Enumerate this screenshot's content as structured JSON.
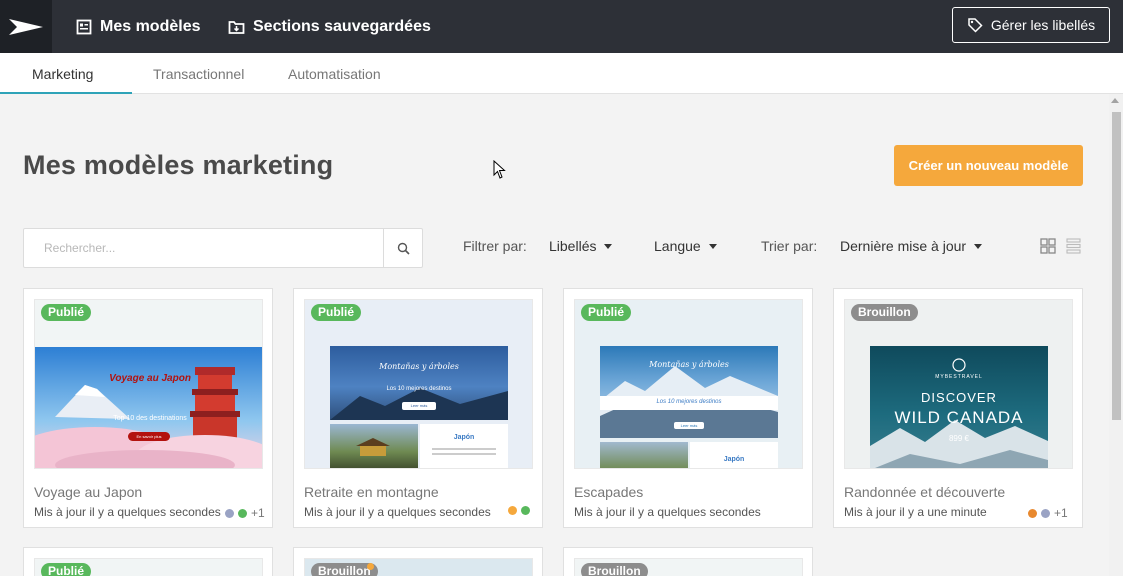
{
  "topbar": {
    "my_templates": "Mes modèles",
    "saved_sections": "Sections sauvegardées",
    "manage_labels": "Gérer les libellés"
  },
  "tabs": [
    {
      "label": "Marketing",
      "active": true
    },
    {
      "label": "Transactionnel",
      "active": false
    },
    {
      "label": "Automatisation",
      "active": false
    }
  ],
  "header": {
    "title": "Mes modèles marketing",
    "create_button": "Créer un nouveau modèle"
  },
  "search": {
    "placeholder": "Rechercher..."
  },
  "filters": {
    "filter_by": "Filtrer par:",
    "labels": "Libellés",
    "language": "Langue",
    "sort_by": "Trier par:",
    "sort_value": "Dernière mise à jour"
  },
  "colors": {
    "accent": "#f5a83c",
    "tab_underline": "#2ea3b8",
    "published": "#58b85c",
    "draft": "#8d8d8d"
  },
  "cards": [
    {
      "status": "Publié",
      "name": "Voyage au Japon",
      "updated": "Mis à jour il y a quelques secondes",
      "dots": [
        "#9aa3c4",
        "#58b85c"
      ],
      "more": "+1",
      "hero_title": "Voyage au Japon",
      "hero_sub": "Top 10 des destinations",
      "hero_cta": "En savoir plus"
    },
    {
      "status": "Publié",
      "name": "Retraite en montagne",
      "updated": "Mis à jour il y a quelques secondes",
      "dots": [
        "#f5a83c",
        "#58b85c"
      ],
      "more": "",
      "hero_title": "Montañas y árboles",
      "hero_sub": "Los 10 mejores destinos",
      "hero_cta": "Leer más",
      "sub_title": "Japón"
    },
    {
      "status": "Publié",
      "name": "Escapades",
      "updated": "Mis à jour il y a quelques secondes",
      "dots": [],
      "more": "",
      "hero_title": "Montañas y árboles",
      "hero_sub": "Los 10 mejores destinos",
      "hero_cta": "Leer más",
      "sub_title": "Japón"
    },
    {
      "status": "Brouillon",
      "name": "Randonnée et découverte",
      "updated": "Mis à jour il y a une minute",
      "dots": [
        "#e8892f",
        "#9aa3c4"
      ],
      "more": "+1",
      "hero_brand": "MYBESTRAVEL",
      "hero_title": "DISCOVER",
      "hero_sub": "WILD CANADA",
      "hero_price": "899 €"
    }
  ],
  "row2_badges": [
    "Publié",
    "Brouillon",
    "Brouillon"
  ]
}
